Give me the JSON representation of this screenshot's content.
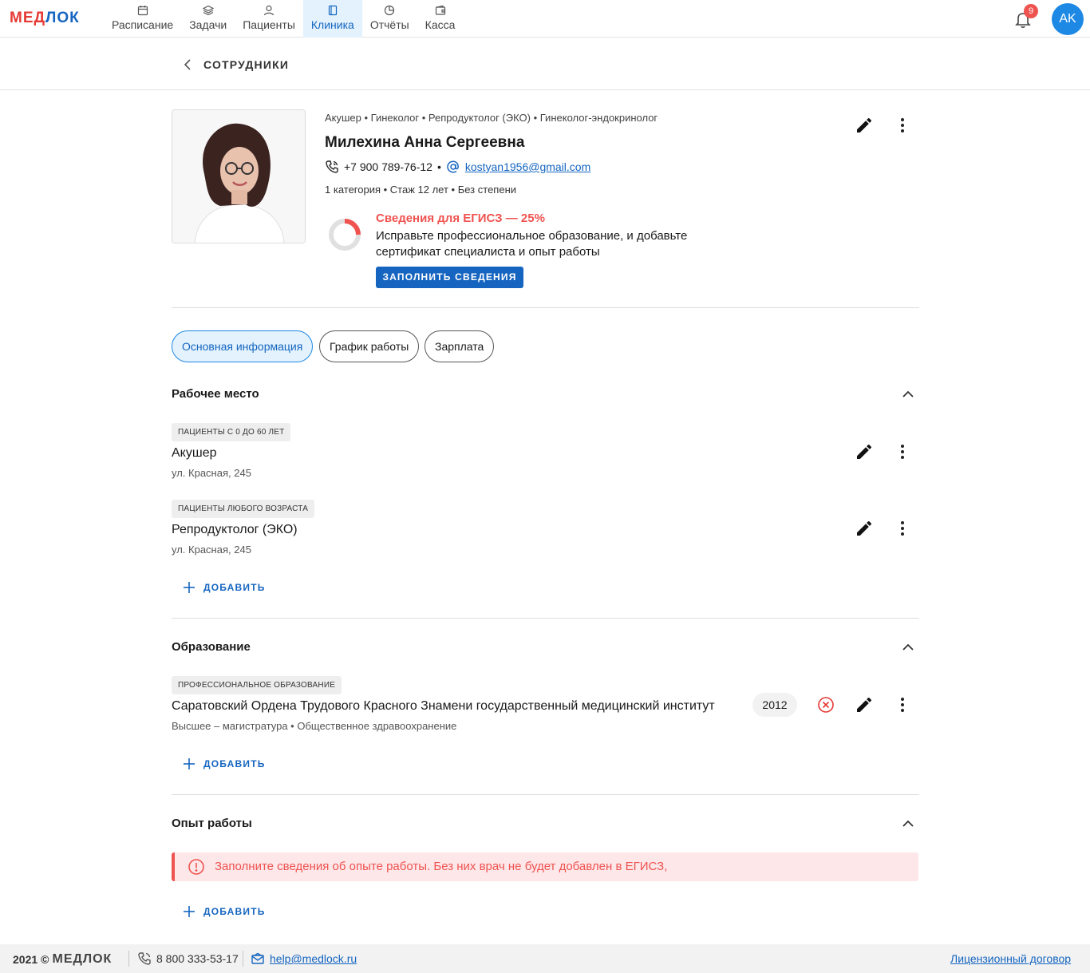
{
  "brand": {
    "logo_part1": "МЕД",
    "logo_part2": "ЛОК"
  },
  "nav": {
    "items": [
      {
        "label": "Расписание",
        "icon": "calendar-icon"
      },
      {
        "label": "Задачи",
        "icon": "layers-icon"
      },
      {
        "label": "Пациенты",
        "icon": "user-icon"
      },
      {
        "label": "Клиника",
        "icon": "book-icon",
        "active": true
      },
      {
        "label": "Отчёты",
        "icon": "pie-chart-icon"
      },
      {
        "label": "Касса",
        "icon": "wallet-icon"
      }
    ],
    "notifications_count": "9",
    "avatar_initials": "AK"
  },
  "breadcrumb": {
    "title": "СОТРУДНИКИ"
  },
  "profile": {
    "specialties": "Акушер • Гинеколог • Репродуктолог (ЭКО) • Гинеколог-эндокринолог",
    "name": "Милехина Анна Сергеевна",
    "phone": "+7 900 789-76-12",
    "separator": "•",
    "email": "kostyan1956@gmail.com",
    "meta": "1 категория • Стаж 12 лет • Без степени",
    "egisz": {
      "title": "Сведения для ЕГИСЗ — 25%",
      "percent": 25,
      "text": "Исправьте профессиональное образование, и добавьте сертификат специалиста и опыт работы",
      "button": "ЗАПОЛНИТЬ СВЕДЕНИЯ"
    }
  },
  "tabs": [
    {
      "label": "Основная информация",
      "active": true
    },
    {
      "label": "График работы"
    },
    {
      "label": "Зарплата"
    }
  ],
  "workplace": {
    "title": "Рабочее место",
    "items": [
      {
        "chip": "ПАЦИЕНТЫ С 0 ДО 60 ЛЕТ",
        "title": "Акушер",
        "address": "ул. Красная, 245"
      },
      {
        "chip": "ПАЦИЕНТЫ ЛЮБОГО ВОЗРАСТА",
        "title": "Репродуктолог (ЭКО)",
        "address": "ул. Красная, 245"
      }
    ],
    "add": "ДОБАВИТЬ"
  },
  "education": {
    "title": "Образование",
    "items": [
      {
        "chip": "ПРОФЕССИОНАЛЬНОЕ ОБРАЗОВАНИЕ",
        "title": "Саратовский Ордена Трудового Красного Знамени государственный медицинский институт",
        "sub": "Высшее – магистратура • Общественное здравоохранение",
        "year": "2012"
      }
    ],
    "add": "ДОБАВИТЬ"
  },
  "experience": {
    "title": "Опыт работы",
    "alert": "Заполните сведения об опыте работы. Без них врач не будет добавлен в ЕГИСЗ,",
    "add": "ДОБАВИТЬ"
  },
  "footer": {
    "year": "2021",
    "copyright_symbol": "©",
    "logo": "МЕДЛОК",
    "phone": "8 800 333-53-17",
    "email": "help@medlock.ru",
    "license": "Лицензионный договор"
  },
  "colors": {
    "accent": "#1565c0",
    "error": "#ef5350",
    "logo_red": "#e53935"
  }
}
